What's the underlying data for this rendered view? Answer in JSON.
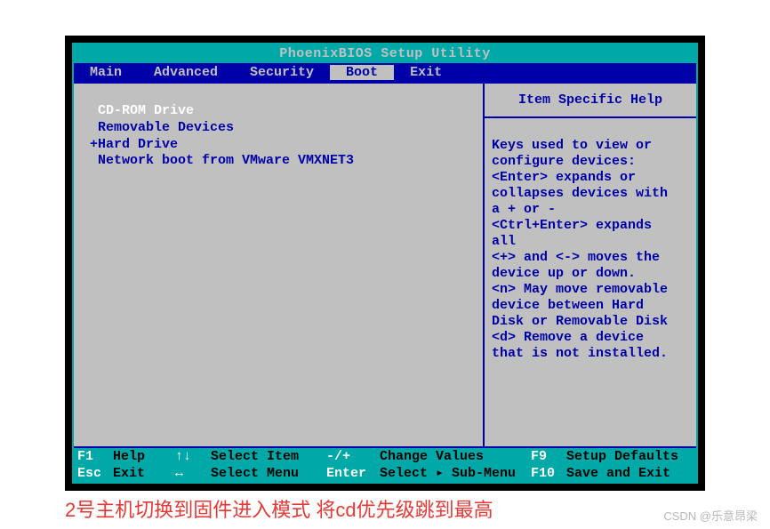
{
  "title": "PhoenixBIOS Setup Utility",
  "menu": {
    "items": [
      "Main",
      "Advanced",
      "Security",
      "Boot",
      "Exit"
    ],
    "active_index": 3
  },
  "boot_list": [
    {
      "label": " CD-ROM Drive",
      "selected": true
    },
    {
      "label": " Removable Devices",
      "selected": false
    },
    {
      "label": "+Hard Drive",
      "selected": false
    },
    {
      "label": " Network boot from VMware VMXNET3",
      "selected": false
    }
  ],
  "help": {
    "title": "Item Specific Help",
    "body": "Keys used to view or\nconfigure devices:\n<Enter> expands or\ncollapses devices with\na + or -\n<Ctrl+Enter> expands\nall\n<+> and <-> moves the\ndevice up or down.\n<n> May move removable\ndevice between Hard\nDisk or Removable Disk\n<d> Remove a device\nthat is not installed."
  },
  "footer": {
    "row1": {
      "k1": "F1",
      "t1": "Help",
      "k2": "↑↓",
      "t2": "Select Item",
      "k3": "-/+",
      "t3": "Change Values",
      "k4": "F9",
      "t4": "Setup Defaults"
    },
    "row2": {
      "k1": "Esc",
      "t1": "Exit",
      "k2": "↔",
      "t2": "Select Menu",
      "k3": "Enter",
      "t3": "Select ▸ Sub-Menu",
      "k4": "F10",
      "t4": "Save and Exit"
    }
  },
  "annotation": "2号主机切换到固件进入模式    将cd优先级跳到最高",
  "watermark": "CSDN @乐意昂梁"
}
